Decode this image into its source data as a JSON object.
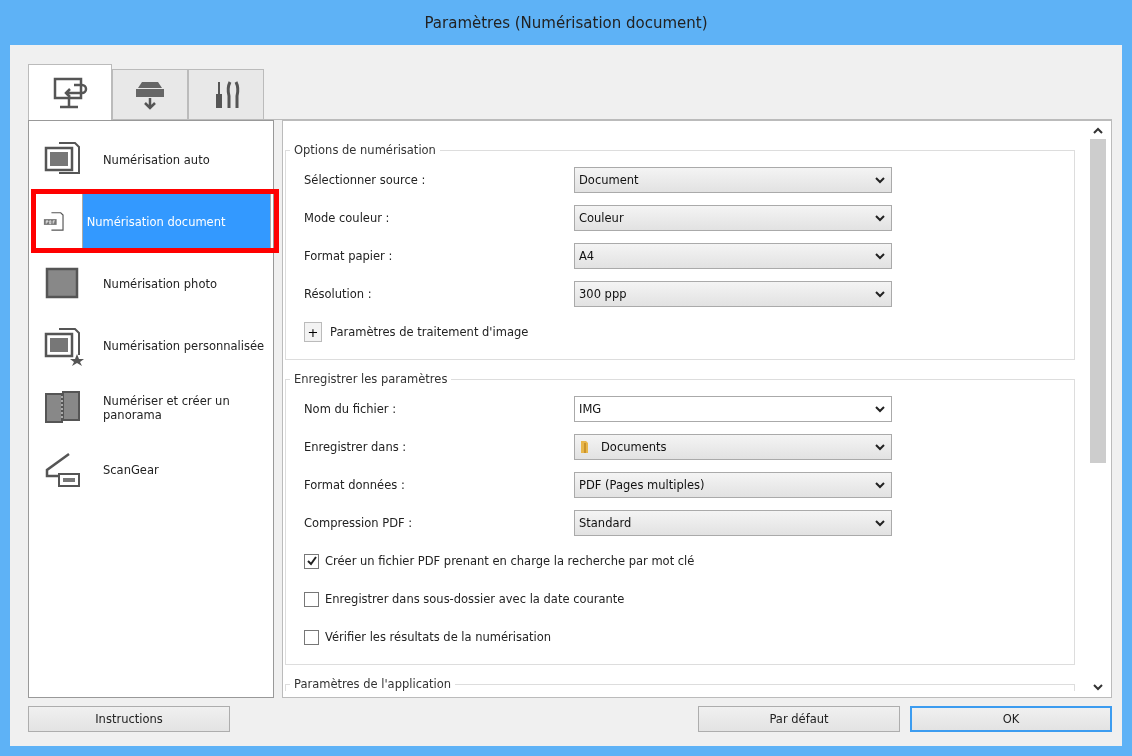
{
  "window": {
    "title": "Paramètres (Numérisation document)"
  },
  "tabs": [
    {
      "selected": true
    },
    {
      "selected": false
    },
    {
      "selected": false
    }
  ],
  "sidebar": {
    "items": [
      {
        "label": "Numérisation auto",
        "selected": false,
        "highlighted": false
      },
      {
        "label": "Numérisation document",
        "selected": true,
        "highlighted": true
      },
      {
        "label": "Numérisation photo",
        "selected": false,
        "highlighted": false
      },
      {
        "label": "Numérisation personnalisée",
        "selected": false,
        "highlighted": false
      },
      {
        "label": "Numériser et créer un panorama",
        "selected": false,
        "highlighted": false
      },
      {
        "label": "ScanGear",
        "selected": false,
        "highlighted": false
      }
    ]
  },
  "groups": [
    {
      "title": "Options de numérisation",
      "rows": [
        {
          "kind": "select",
          "label": "Sélectionner source :",
          "value": "Document"
        },
        {
          "kind": "select",
          "label": "Mode couleur :",
          "value": "Couleur"
        },
        {
          "kind": "select",
          "label": "Format papier :",
          "value": "A4"
        },
        {
          "kind": "select",
          "label": "Résolution :",
          "value": "300 ppp"
        },
        {
          "kind": "expander",
          "label": "Paramètres de traitement d'image",
          "symbol": "+",
          "expanded": false
        }
      ]
    },
    {
      "title": "Enregistrer les paramètres",
      "rows": [
        {
          "kind": "editable",
          "label": "Nom du fichier :",
          "value": "IMG"
        },
        {
          "kind": "folder",
          "label": "Enregistrer dans :",
          "value": "Documents"
        },
        {
          "kind": "select",
          "label": "Format données :",
          "value": "PDF (Pages multiples)"
        },
        {
          "kind": "select",
          "label": "Compression PDF :",
          "value": "Standard"
        },
        {
          "kind": "checkbox",
          "label": "Créer un fichier PDF prenant en charge la recherche par mot clé",
          "checked": true
        },
        {
          "kind": "checkbox",
          "label": "Enregistrer dans sous-dossier avec la date courante",
          "checked": false
        },
        {
          "kind": "checkbox",
          "label": "Vérifier les résultats de la numérisation",
          "checked": false
        }
      ]
    },
    {
      "title": "Paramètres de l'application"
    }
  ],
  "buttons": [
    {
      "label": "Instructions",
      "default": false
    },
    {
      "label": "Par défaut",
      "default": false
    },
    {
      "label": "OK",
      "default": true
    }
  ]
}
